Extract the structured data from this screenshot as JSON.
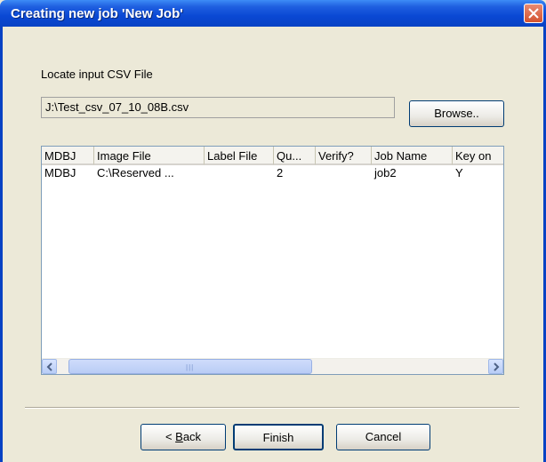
{
  "window": {
    "title": "Creating new job 'New Job'"
  },
  "csv": {
    "label": "Locate input CSV File",
    "path": "J:\\Test_csv_07_10_08B.csv",
    "browse_label": "Browse.."
  },
  "table": {
    "columns": [
      "MDBJ",
      "Image File",
      "Label File",
      "Qu...",
      "Verify?",
      "Job Name",
      "Key on"
    ],
    "rows": [
      [
        "MDBJ",
        "C:\\Reserved ...",
        "",
        "2",
        "",
        "job2",
        "Y"
      ]
    ]
  },
  "buttons": {
    "back_prefix": "< ",
    "back_mnemonic": "B",
    "back_rest": "ack",
    "finish": "Finish",
    "cancel": "Cancel"
  },
  "icons": {
    "close": "close-icon",
    "scroll_left": "arrow-left-icon",
    "scroll_right": "arrow-right-icon"
  }
}
